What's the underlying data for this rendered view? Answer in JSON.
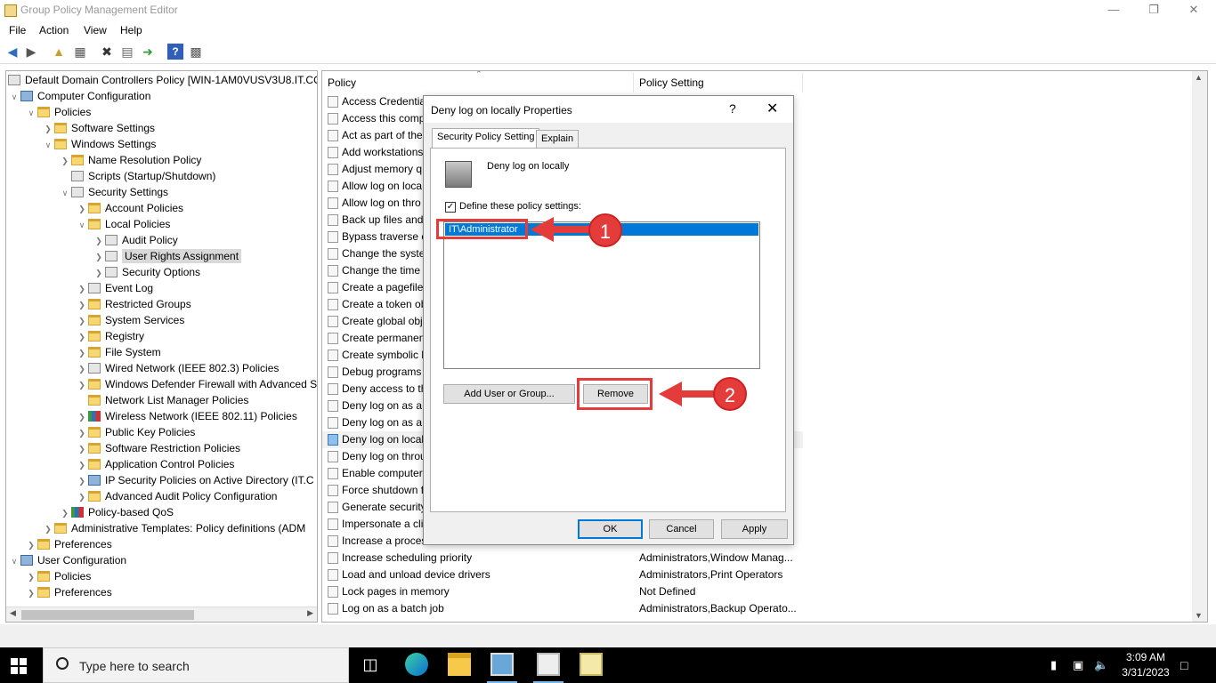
{
  "window": {
    "title": "Group Policy Management Editor",
    "minimize_icon": "minimize-icon",
    "maximize_icon": "restore-icon",
    "close_icon": "close-icon"
  },
  "menu": [
    "File",
    "Action",
    "View",
    "Help"
  ],
  "toolbar": [
    "back-icon",
    "forward-icon",
    "up-folder-icon",
    "show-hide-tree-icon",
    "delete-icon",
    "properties-icon",
    "export-list-icon",
    "help-icon",
    "view-icon"
  ],
  "tree": {
    "items": [
      {
        "label": "Default Domain Controllers Policy [WIN-1AM0VUSV3U8.IT.CO",
        "icon": "policy-icon"
      },
      {
        "label": "Computer Configuration",
        "icon": "computer-icon"
      },
      {
        "label": "Policies",
        "icon": "folder-icon"
      },
      {
        "label": "Software Settings",
        "icon": "folder-icon"
      },
      {
        "label": "Windows Settings",
        "icon": "folder-icon"
      },
      {
        "label": "Name Resolution Policy",
        "icon": "folder-icon"
      },
      {
        "label": "Scripts (Startup/Shutdown)",
        "icon": "script-icon"
      },
      {
        "label": "Security Settings",
        "icon": "security-icon"
      },
      {
        "label": "Account Policies",
        "icon": "folder-icon"
      },
      {
        "label": "Local Policies",
        "icon": "folder-icon"
      },
      {
        "label": "Audit Policy",
        "icon": "folder-icon"
      },
      {
        "label": "User Rights Assignment",
        "icon": "folder-icon"
      },
      {
        "label": "Security Options",
        "icon": "folder-icon"
      },
      {
        "label": "Event Log",
        "icon": "folder-icon"
      },
      {
        "label": "Restricted Groups",
        "icon": "folder-icon"
      },
      {
        "label": "System Services",
        "icon": "folder-icon"
      },
      {
        "label": "Registry",
        "icon": "folder-icon"
      },
      {
        "label": "File System",
        "icon": "folder-icon"
      },
      {
        "label": "Wired Network (IEEE 802.3) Policies",
        "icon": "network-icon"
      },
      {
        "label": "Windows Defender Firewall with Advanced S",
        "icon": "folder-icon"
      },
      {
        "label": "Network List Manager Policies",
        "icon": "folder-icon"
      },
      {
        "label": "Wireless Network (IEEE 802.11) Policies",
        "icon": "wireless-icon"
      },
      {
        "label": "Public Key Policies",
        "icon": "folder-icon"
      },
      {
        "label": "Software Restriction Policies",
        "icon": "folder-icon"
      },
      {
        "label": "Application Control Policies",
        "icon": "folder-icon"
      },
      {
        "label": "IP Security Policies on Active Directory (IT.C",
        "icon": "ipsec-icon"
      },
      {
        "label": "Advanced Audit Policy Configuration",
        "icon": "folder-icon"
      },
      {
        "label": "Policy-based QoS",
        "icon": "chart-bars-icon"
      },
      {
        "label": "Administrative Templates: Policy definitions (ADM",
        "icon": "folder-icon"
      },
      {
        "label": "Preferences",
        "icon": "folder-icon"
      },
      {
        "label": "User Configuration",
        "icon": "user-icon"
      },
      {
        "label": "Policies",
        "icon": "folder-icon"
      },
      {
        "label": "Preferences",
        "icon": "folder-icon"
      }
    ]
  },
  "list": {
    "col_policy": "Policy",
    "col_setting": "Policy Setting",
    "rows": [
      {
        "policy": "Access Credentia",
        "setting": ""
      },
      {
        "policy": "Access this comp",
        "setting": ""
      },
      {
        "policy": "Act as part of the",
        "setting": ""
      },
      {
        "policy": "Add workstations",
        "setting": ""
      },
      {
        "policy": "Adjust memory q",
        "setting": ""
      },
      {
        "policy": "Allow log on loca",
        "setting": ""
      },
      {
        "policy": "Allow log on thro",
        "setting": ""
      },
      {
        "policy": "Back up files and",
        "setting": ""
      },
      {
        "policy": "Bypass traverse c",
        "setting": ""
      },
      {
        "policy": "Change the syste",
        "setting": ""
      },
      {
        "policy": "Change the time",
        "setting": ""
      },
      {
        "policy": "Create a pagefile",
        "setting": ""
      },
      {
        "policy": "Create a token ob",
        "setting": ""
      },
      {
        "policy": "Create global obj",
        "setting": ""
      },
      {
        "policy": "Create permanen",
        "setting": ""
      },
      {
        "policy": "Create symbolic l",
        "setting": ""
      },
      {
        "policy": "Debug programs",
        "setting": ""
      },
      {
        "policy": "Deny access to th",
        "setting": ""
      },
      {
        "policy": "Deny log on as a",
        "setting": ""
      },
      {
        "policy": "Deny log on as a",
        "setting": ""
      },
      {
        "policy": "Deny log on local",
        "setting": ""
      },
      {
        "policy": "Deny log on throu",
        "setting": ""
      },
      {
        "policy": "Enable computer",
        "setting": ""
      },
      {
        "policy": "Force shutdown f",
        "setting": ""
      },
      {
        "policy": "Generate security",
        "setting": ""
      },
      {
        "policy": "Impersonate a cli",
        "setting": ""
      },
      {
        "policy": "Increase a proces",
        "setting": ""
      },
      {
        "policy": "Increase scheduling priority",
        "setting": "Administrators,Window Manag..."
      },
      {
        "policy": "Load and unload device drivers",
        "setting": "Administrators,Print Operators"
      },
      {
        "policy": "Lock pages in memory",
        "setting": "Not Defined"
      },
      {
        "policy": "Log on as a batch job",
        "setting": "Administrators,Backup Operato..."
      }
    ]
  },
  "dialog": {
    "title": "Deny log on locally Properties",
    "help": "?",
    "close": "✕",
    "tabs": [
      "Security Policy Setting",
      "Explain"
    ],
    "policy_name": "Deny log on locally",
    "checkbox_label": "Define these policy settings:",
    "checkbox_mark": "✓",
    "accounts": [
      "IT\\Administrator"
    ],
    "add_button": "Add User or Group...",
    "remove_button": "Remove",
    "ok": "OK",
    "cancel": "Cancel",
    "apply": "Apply"
  },
  "annotations": [
    "1",
    "2"
  ],
  "taskbar": {
    "search_placeholder": "Type here to search",
    "time": "3:09 AM",
    "date": "3/31/2023"
  },
  "colors": {
    "accent": "#0078d7",
    "annotation": "#e43b3b"
  }
}
